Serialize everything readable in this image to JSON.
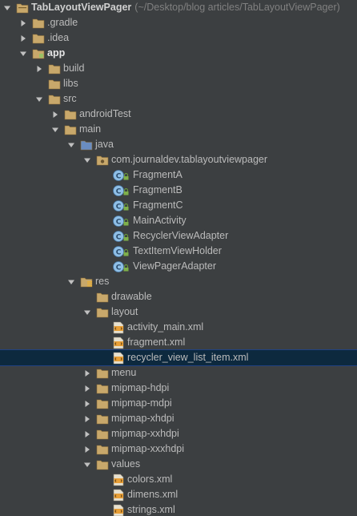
{
  "tree": [
    {
      "label": "TabLayoutViewPager",
      "path": "(~/Desktop/blog articles/TabLayoutViewPager)",
      "level": 0,
      "arrow": "down",
      "icon": "project-folder-icon",
      "style": "bold"
    },
    {
      "label": ".gradle",
      "level": 1,
      "arrow": "right",
      "icon": "folder-icon"
    },
    {
      "label": ".idea",
      "level": 1,
      "arrow": "right",
      "icon": "folder-icon"
    },
    {
      "label": "app",
      "level": 1,
      "arrow": "down",
      "icon": "module-folder-icon",
      "style": "module"
    },
    {
      "label": "build",
      "level": 2,
      "arrow": "right",
      "icon": "folder-icon"
    },
    {
      "label": "libs",
      "level": 2,
      "arrow": "none",
      "icon": "folder-icon"
    },
    {
      "label": "src",
      "level": 2,
      "arrow": "down",
      "icon": "folder-icon"
    },
    {
      "label": "androidTest",
      "level": 3,
      "arrow": "right",
      "icon": "folder-icon"
    },
    {
      "label": "main",
      "level": 3,
      "arrow": "down",
      "icon": "folder-icon"
    },
    {
      "label": "java",
      "level": 4,
      "arrow": "down",
      "icon": "source-folder-icon"
    },
    {
      "label": "com.journaldev.tablayoutviewpager",
      "level": 5,
      "arrow": "down",
      "icon": "package-icon"
    },
    {
      "label": "FragmentA",
      "level": 6,
      "arrow": "none",
      "icon": "java-class-icon"
    },
    {
      "label": "FragmentB",
      "level": 6,
      "arrow": "none",
      "icon": "java-class-icon"
    },
    {
      "label": "FragmentC",
      "level": 6,
      "arrow": "none",
      "icon": "java-class-icon"
    },
    {
      "label": "MainActivity",
      "level": 6,
      "arrow": "none",
      "icon": "java-class-icon"
    },
    {
      "label": "RecyclerViewAdapter",
      "level": 6,
      "arrow": "none",
      "icon": "java-class-icon"
    },
    {
      "label": "TextItemViewHolder",
      "level": 6,
      "arrow": "none",
      "icon": "java-class-icon"
    },
    {
      "label": "ViewPagerAdapter",
      "level": 6,
      "arrow": "none",
      "icon": "java-class-icon"
    },
    {
      "label": "res",
      "level": 4,
      "arrow": "down",
      "icon": "resource-folder-icon"
    },
    {
      "label": "drawable",
      "level": 5,
      "arrow": "none",
      "icon": "folder-icon"
    },
    {
      "label": "layout",
      "level": 5,
      "arrow": "down",
      "icon": "folder-icon"
    },
    {
      "label": "activity_main.xml",
      "level": 6,
      "arrow": "none",
      "icon": "xml-file-icon"
    },
    {
      "label": "fragment.xml",
      "level": 6,
      "arrow": "none",
      "icon": "xml-file-icon"
    },
    {
      "label": "recycler_view_list_item.xml",
      "level": 6,
      "arrow": "none",
      "icon": "xml-file-icon",
      "selected": true
    },
    {
      "label": "menu",
      "level": 5,
      "arrow": "right",
      "icon": "folder-icon"
    },
    {
      "label": "mipmap-hdpi",
      "level": 5,
      "arrow": "right",
      "icon": "folder-icon"
    },
    {
      "label": "mipmap-mdpi",
      "level": 5,
      "arrow": "right",
      "icon": "folder-icon"
    },
    {
      "label": "mipmap-xhdpi",
      "level": 5,
      "arrow": "right",
      "icon": "folder-icon"
    },
    {
      "label": "mipmap-xxhdpi",
      "level": 5,
      "arrow": "right",
      "icon": "folder-icon"
    },
    {
      "label": "mipmap-xxxhdpi",
      "level": 5,
      "arrow": "right",
      "icon": "folder-icon"
    },
    {
      "label": "values",
      "level": 5,
      "arrow": "down",
      "icon": "folder-icon"
    },
    {
      "label": "colors.xml",
      "level": 6,
      "arrow": "none",
      "icon": "xml-file-icon"
    },
    {
      "label": "dimens.xml",
      "level": 6,
      "arrow": "none",
      "icon": "xml-file-icon"
    },
    {
      "label": "strings.xml",
      "level": 6,
      "arrow": "none",
      "icon": "xml-file-icon"
    }
  ],
  "colors": {
    "background": "#3c3f41",
    "selection": "#0d293e",
    "text": "#bbbbbb",
    "path": "#808080",
    "folder": "#c8a86b",
    "source_folder": "#6a8dbf",
    "class_circle": "#8fbfe6",
    "xml_icon": "#e89f37"
  }
}
